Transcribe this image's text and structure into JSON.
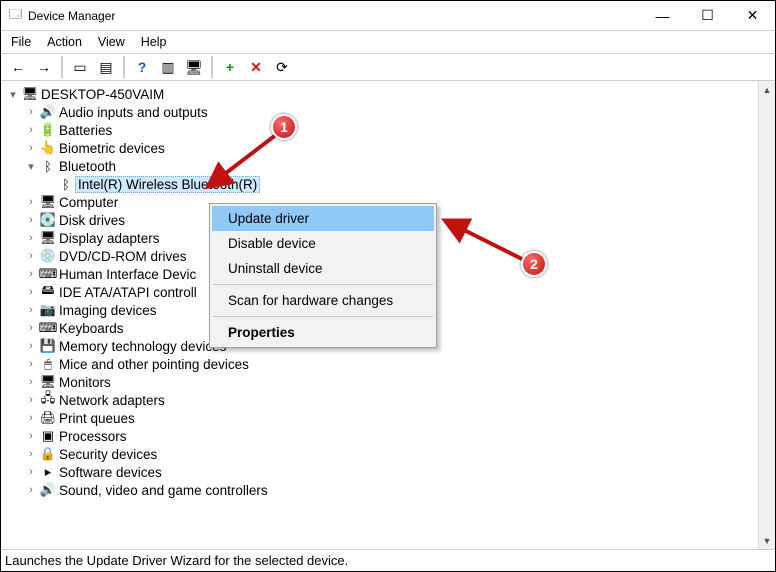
{
  "window": {
    "title": "Device Manager"
  },
  "menubar": [
    "File",
    "Action",
    "View",
    "Help"
  ],
  "toolbar": {
    "back": "←",
    "forward": "→",
    "show_hidden": "▭",
    "properties": "▤",
    "help": "?",
    "scan": "▥",
    "monitor": "🖥",
    "add": "+",
    "remove": "✕",
    "update": "⟳"
  },
  "tree": {
    "root": "DESKTOP-450VAIM",
    "items": [
      {
        "label": "Audio inputs and outputs",
        "icon": "🔊"
      },
      {
        "label": "Batteries",
        "icon": "🔋"
      },
      {
        "label": "Biometric devices",
        "icon": "👆"
      },
      {
        "label": "Bluetooth",
        "icon": "ᛒ",
        "expanded": true,
        "children": [
          {
            "label": "Intel(R) Wireless Bluetooth(R)",
            "icon": "ᛒ",
            "selected": true
          }
        ]
      },
      {
        "label": "Computer",
        "icon": "🖥"
      },
      {
        "label": "Disk drives",
        "icon": "💽"
      },
      {
        "label": "Display adapters",
        "icon": "🖥"
      },
      {
        "label": "DVD/CD-ROM drives",
        "icon": "💿"
      },
      {
        "label": "Human Interface Devic",
        "icon": "⌨"
      },
      {
        "label": "IDE ATA/ATAPI controll",
        "icon": "🖴"
      },
      {
        "label": "Imaging devices",
        "icon": "📷"
      },
      {
        "label": "Keyboards",
        "icon": "⌨"
      },
      {
        "label": "Memory technology devices",
        "icon": "💾"
      },
      {
        "label": "Mice and other pointing devices",
        "icon": "🖱"
      },
      {
        "label": "Monitors",
        "icon": "🖥"
      },
      {
        "label": "Network adapters",
        "icon": "🖧"
      },
      {
        "label": "Print queues",
        "icon": "🖨"
      },
      {
        "label": "Processors",
        "icon": "▣"
      },
      {
        "label": "Security devices",
        "icon": "🔒"
      },
      {
        "label": "Software devices",
        "icon": "▸"
      },
      {
        "label": "Sound, video and game controllers",
        "icon": "🔊"
      }
    ]
  },
  "context_menu": {
    "items": [
      {
        "label": "Update driver",
        "highlight": true
      },
      {
        "label": "Disable device"
      },
      {
        "label": "Uninstall device"
      },
      {
        "sep": true
      },
      {
        "label": "Scan for hardware changes"
      },
      {
        "sep": true
      },
      {
        "label": "Properties",
        "bold": true
      }
    ]
  },
  "callouts": {
    "one": "1",
    "two": "2"
  },
  "status": "Launches the Update Driver Wizard for the selected device."
}
